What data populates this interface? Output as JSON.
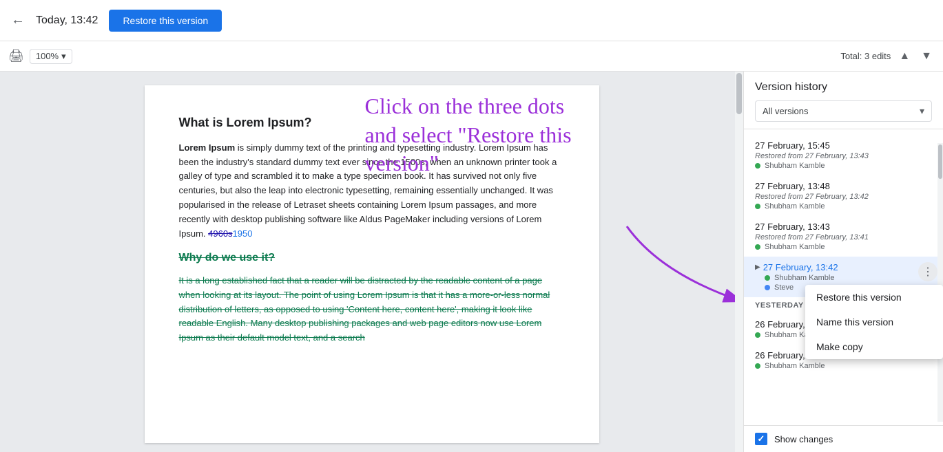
{
  "topbar": {
    "date": "Today, 13:42",
    "restore_btn": "Restore this version",
    "back_icon": "←"
  },
  "toolbar": {
    "print_icon": "🖨",
    "zoom": "100%",
    "zoom_arrow": "▾",
    "total_edits": "Total: 3 edits",
    "nav_up": "▲",
    "nav_down": "▼"
  },
  "document": {
    "h1": "What is Lorem Ipsum?",
    "p1_bold": "Lorem Ipsum",
    "p1_rest": " is simply dummy text of the printing and typesetting industry. Lorem Ipsum has been the industry's standard dummy text ever since the 1500s, when an unknown printer took a galley of type and scrambled it to make a type specimen book. It has survived not only five centuries, but also the leap into electronic typesetting, remaining essentially unchanged. It was popularised in the release of Letraset sheets containing Lorem Ipsum passages, and more recently with desktop publishing software like Aldus PageMaker including versions of Lorem Ipsum.",
    "link_old": "4960s",
    "link_new": "1950",
    "h2": "Why do we use it?",
    "p2": "It is a long established fact that a reader will be distracted by the readable content of a page when looking at its layout. The point of using Lorem Ipsum is that it has a more-or-less normal distribution of letters, as opposed to using 'Content here, content here', making it look like readable English. Many desktop publishing packages and web page editors now use Lorem Ipsum as their default model text, and a search"
  },
  "annotation": {
    "text": "Click on the three dots and select \"Restore this version\""
  },
  "sidebar": {
    "title": "Version history",
    "filter_label": "All versions",
    "filter_arrow": "▾",
    "versions": [
      {
        "date": "27 February, 15:45",
        "info": "Restored from 27 February, 13:43",
        "users": [
          "Shubham Kamble"
        ],
        "dot_color": "green",
        "active": false
      },
      {
        "date": "27 February, 13:48",
        "info": "Restored from 27 February, 13:42",
        "users": [
          "Shubham Kamble"
        ],
        "dot_color": "green",
        "active": false
      },
      {
        "date": "27 February, 13:43",
        "info": "Restored from 27 February, 13:41",
        "users": [
          "Shubham Kamble"
        ],
        "dot_color": "green",
        "active": false
      },
      {
        "date": "27 February, 13:42",
        "info": "",
        "users": [
          "Shubham Kamble",
          "Steve"
        ],
        "dot_colors": [
          "green",
          "blue"
        ],
        "active": true,
        "has_menu": true
      }
    ],
    "section_label": "YESTERDAY",
    "yesterday_versions": [
      {
        "date": "26 February, ...",
        "info": "",
        "users": [
          "Shubham Kamble"
        ],
        "dot_color": "green",
        "active": false
      },
      {
        "date": "26 February, 15:50",
        "info": "",
        "users": [
          "Shubham Kamble"
        ],
        "dot_color": "green",
        "active": false
      }
    ],
    "context_menu": {
      "item1": "Restore this version",
      "item2": "Name this version",
      "item3": "Make copy"
    },
    "footer": {
      "label": "Show changes"
    }
  }
}
